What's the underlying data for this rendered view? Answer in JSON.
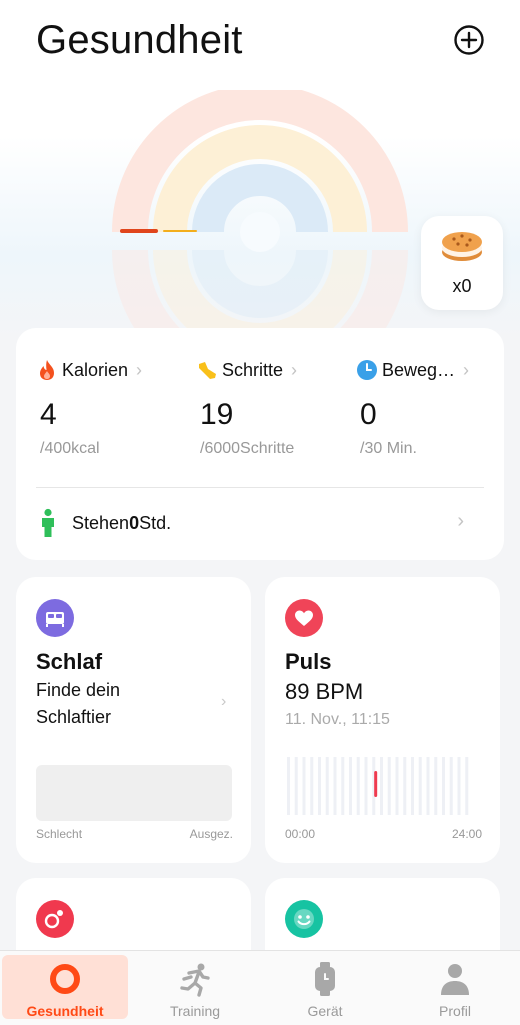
{
  "header": {
    "title": "Gesundheit"
  },
  "cookie": {
    "count": "x0"
  },
  "activity": {
    "calories": {
      "label": "Kalorien",
      "value": "4",
      "goal": "/400kcal"
    },
    "steps": {
      "label": "Schritte",
      "value": "19",
      "goal": "/6000Schritte"
    },
    "movement": {
      "label": "Beweg…",
      "value": "0",
      "goal": "/30 Min."
    },
    "stand": {
      "label": "Stehen ",
      "value": "0",
      "unit": "Std."
    },
    "ring_progress": {
      "calories": 0.01,
      "steps": 0.003,
      "movement": 0
    }
  },
  "sleep": {
    "title": "Schlaf",
    "subtitle": "Finde dein Schlaftier",
    "left_label": "Schlecht",
    "right_label": "Ausgez."
  },
  "pulse": {
    "title": "Puls",
    "value": "89 BPM",
    "time": "11. Nov., 11:15",
    "start": "00:00",
    "end": "24:00"
  },
  "tabs": [
    {
      "label": "Gesundheit",
      "active": true
    },
    {
      "label": "Training",
      "active": false
    },
    {
      "label": "Gerät",
      "active": false
    },
    {
      "label": "Profil",
      "active": false
    }
  ],
  "colors": {
    "accent": "#ff4a16",
    "calories": "#f4511e",
    "steps": "#f9c01a",
    "movement": "#3aa0e8",
    "stand": "#2fbf5a",
    "sleep_icon": "#7d6be0",
    "pulse_icon": "#f04458",
    "o2_icon": "#f0394e",
    "mood_icon": "#17c3a2"
  },
  "icons": [
    "plus-circle-icon",
    "cookie-icon",
    "flame-icon",
    "shoe-icon",
    "clock-icon",
    "standing-person-icon",
    "bed-icon",
    "heart-icon",
    "o2-icon",
    "smile-icon",
    "ring-icon",
    "running-icon",
    "watch-icon",
    "person-icon"
  ]
}
